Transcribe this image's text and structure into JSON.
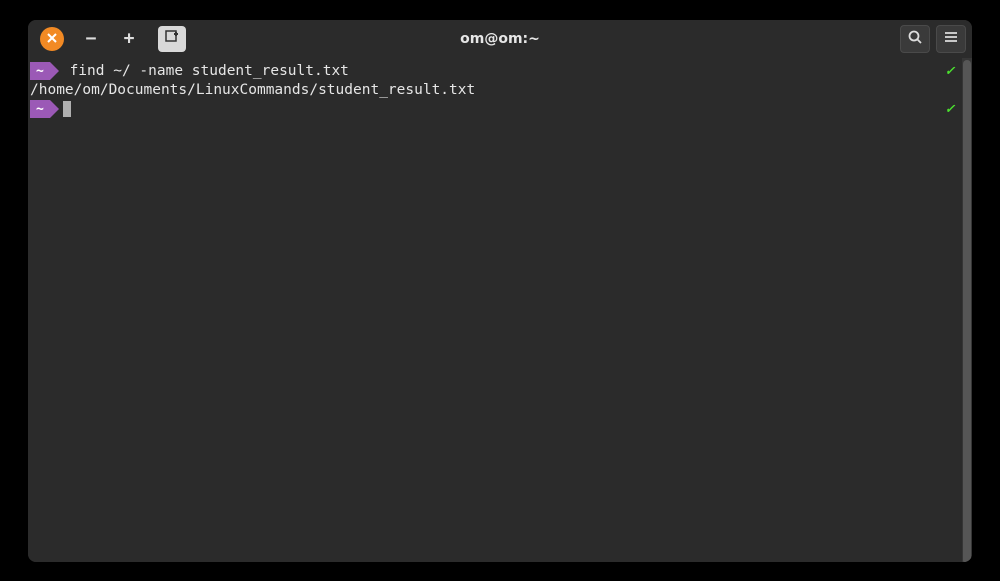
{
  "window": {
    "title": "om@om:~"
  },
  "terminal": {
    "lines": [
      {
        "prompt": "~",
        "command": "find ~/ -name student_result.txt",
        "status": "✓"
      },
      {
        "output": "/home/om/Documents/LinuxCommands/student_result.txt"
      },
      {
        "prompt": "~",
        "command": "",
        "cursor": true,
        "status": "✓"
      }
    ]
  },
  "icons": {
    "close": "close-icon",
    "minus": "−",
    "plus": "+",
    "newtab": "newtab-icon",
    "search": "search-icon",
    "menu": "menu-icon"
  }
}
